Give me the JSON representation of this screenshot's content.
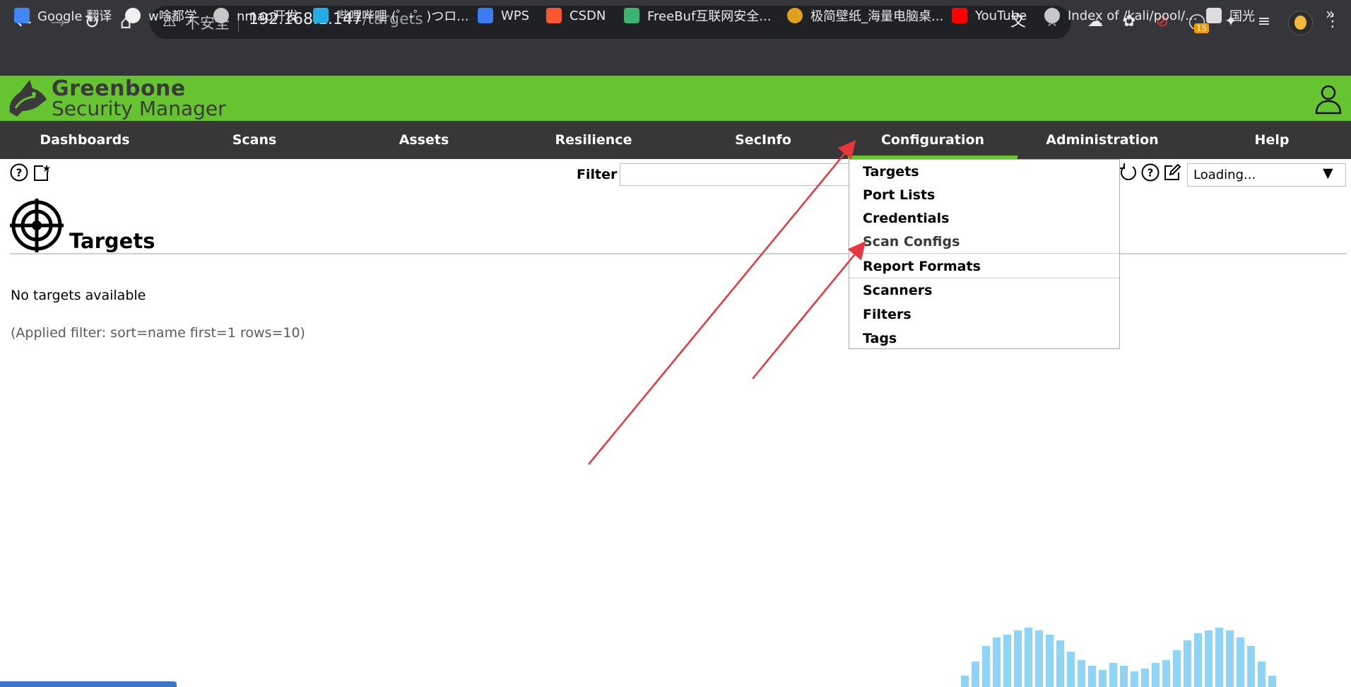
{
  "browser": {
    "address": {
      "insecure_label": "不安全",
      "host": "192.168.1.147",
      "path": "/targets"
    },
    "extension_badge": "15",
    "bookmarks": [
      {
        "label": "Google 翻译",
        "color": "#4285f4"
      },
      {
        "label": "w啥都学",
        "color": "#f0f0f0"
      },
      {
        "label": "nmap开发",
        "color": "#c8c8c8"
      },
      {
        "label": "哔哩哔哩 (゜-゜)つロ...",
        "color": "#23ade5"
      },
      {
        "label": "WPS",
        "color": "#3b7bf6"
      },
      {
        "label": "CSDN",
        "color": "#fc5531"
      },
      {
        "label": "FreeBuf互联网安全...",
        "color": "#3cb371"
      },
      {
        "label": "极简壁纸_海量电脑桌...",
        "color": "#e0a020"
      },
      {
        "label": "YouTube",
        "color": "#ff0000"
      },
      {
        "label": "Index of /kali/pool/...",
        "color": "#c8c8c8"
      },
      {
        "label": "国光",
        "color": "#dddddd"
      }
    ]
  },
  "app": {
    "logo_line1": "Greenbone",
    "logo_line2": "Security Manager",
    "brand_color": "#66c430",
    "nav_color": "#393637"
  },
  "nav": {
    "items": [
      "Dashboards",
      "Scans",
      "Assets",
      "Resilience",
      "SecInfo",
      "Configuration",
      "Administration",
      "Help"
    ],
    "active": "Configuration"
  },
  "toolbar": {
    "filter_label": "Filter",
    "filter_value": "",
    "select_value": "Loading..."
  },
  "config_menu": {
    "items": [
      "Targets",
      "Port Lists",
      "Credentials",
      "Scan Configs",
      "Report Formats",
      "Scanners",
      "Filters",
      "Tags"
    ],
    "hovered": "Scan Configs"
  },
  "page": {
    "title": "Targets",
    "empty_message": "No targets available",
    "applied_filter": "(Applied filter: sort=name first=1 rows=10)"
  },
  "annotation_color": "#e8363c"
}
